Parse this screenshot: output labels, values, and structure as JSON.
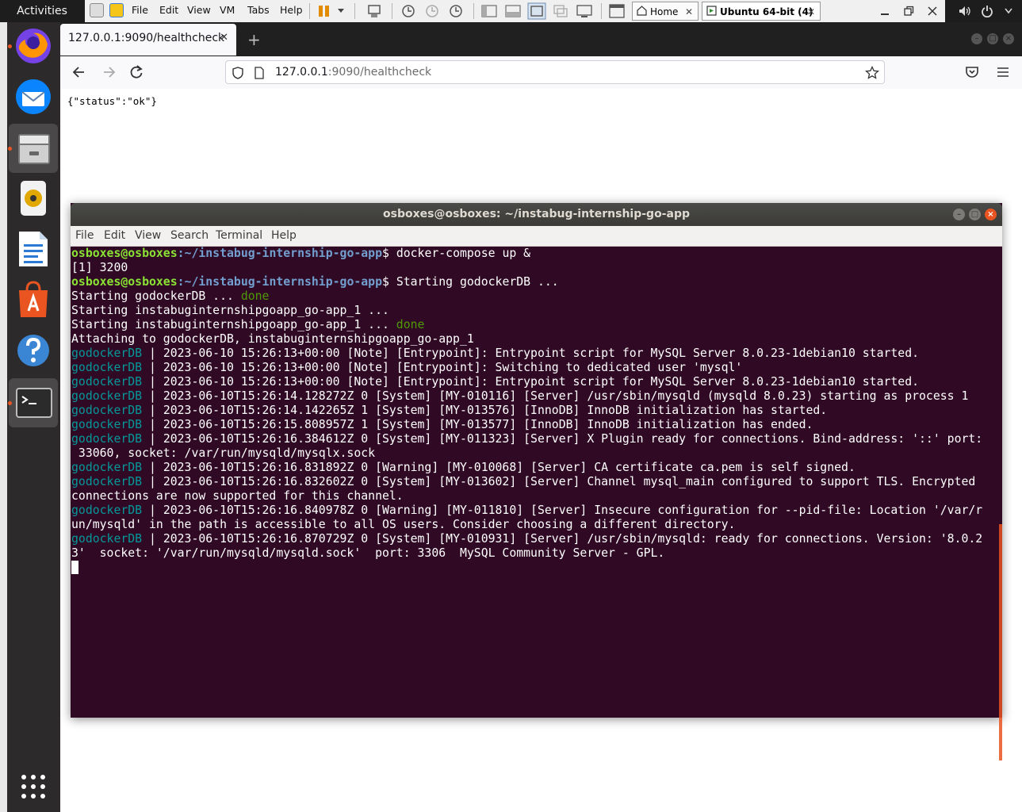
{
  "topbar": {
    "activities": "Activities"
  },
  "vmware": {
    "menus": [
      "File",
      "Edit",
      "View",
      "VM",
      "Tabs",
      "Help"
    ],
    "tabs": [
      {
        "label": "Home",
        "active": false
      },
      {
        "label": "Ubuntu 64-bit (4)",
        "active": true
      }
    ],
    "close_glyph": "✕"
  },
  "dock": {
    "apps": [
      "firefox-icon",
      "thunderbird-icon",
      "files-icon",
      "rhythmbox-icon",
      "libreoffice-writer-icon",
      "ubuntu-software-icon",
      "help-icon",
      "terminal-icon"
    ]
  },
  "firefox": {
    "tab_title": "127.0.0.1:9090/healthcheck",
    "tab_close": "✕",
    "new_tab": "+",
    "url_host": "127.0.0.1",
    "url_rest": ":9090/healthcheck",
    "page_body": "{\"status\":\"ok\"}"
  },
  "terminal": {
    "title": "osboxes@osboxes: ~/instabug-internship-go-app",
    "menus": [
      "File",
      "Edit",
      "View",
      "Search",
      "Terminal",
      "Help"
    ],
    "prompt_user": "osboxes@osboxes",
    "prompt_path": ":~/instabug-internship-go-app",
    "cmd1": "$ docker-compose up &",
    "line_job": "[1] 3200",
    "cmd2": "$ Starting godockerDB ...",
    "line_start1": "Starting godockerDB ... ",
    "done": "done",
    "line_start2": "Starting instabuginternshipgoapp_go-app_1 ...",
    "line_start3": "Starting instabuginternshipgoapp_go-app_1 ... ",
    "line_attach": "Attaching to godockerDB, instabuginternshipgoapp_go-app_1",
    "svc": "godockerDB",
    "log": [
      " | 2023-06-10 15:26:13+00:00 [Note] [Entrypoint]: Entrypoint script for MySQL Server 8.0.23-1debian10 started.",
      " | 2023-06-10 15:26:13+00:00 [Note] [Entrypoint]: Switching to dedicated user 'mysql'",
      " | 2023-06-10 15:26:13+00:00 [Note] [Entrypoint]: Entrypoint script for MySQL Server 8.0.23-1debian10 started.",
      " | 2023-06-10T15:26:14.128272Z 0 [System] [MY-010116] [Server] /usr/sbin/mysqld (mysqld 8.0.23) starting as process 1",
      " | 2023-06-10T15:26:14.142265Z 1 [System] [MY-013576] [InnoDB] InnoDB initialization has started.",
      " | 2023-06-10T15:26:15.808957Z 1 [System] [MY-013577] [InnoDB] InnoDB initialization has ended.",
      " | 2023-06-10T15:26:16.384612Z 0 [System] [MY-011323] [Server] X Plugin ready for connections. Bind-address: '::' port:",
      " | 2023-06-10T15:26:16.831892Z 0 [Warning] [MY-010068] [Server] CA certificate ca.pem is self signed.",
      " | 2023-06-10T15:26:16.832602Z 0 [System] [MY-013602] [Server] Channel mysql_main configured to support TLS. Encrypted",
      " | 2023-06-10T15:26:16.840978Z 0 [Warning] [MY-011810] [Server] Insecure configuration for --pid-file: Location '/var/r",
      " | 2023-06-10T15:26:16.870729Z 0 [System] [MY-010931] [Server] /usr/sbin/mysqld: ready for connections. Version: '8.0.2"
    ],
    "wrap": [
      " 33060, socket: /var/run/mysqld/mysqlx.sock",
      "connections are now supported for this channel.",
      "un/mysqld' in the path is accessible to all OS users. Consider choosing a different directory.",
      "3'  socket: '/var/run/mysqld/mysqld.sock'  port: 3306  MySQL Community Server - GPL."
    ]
  }
}
